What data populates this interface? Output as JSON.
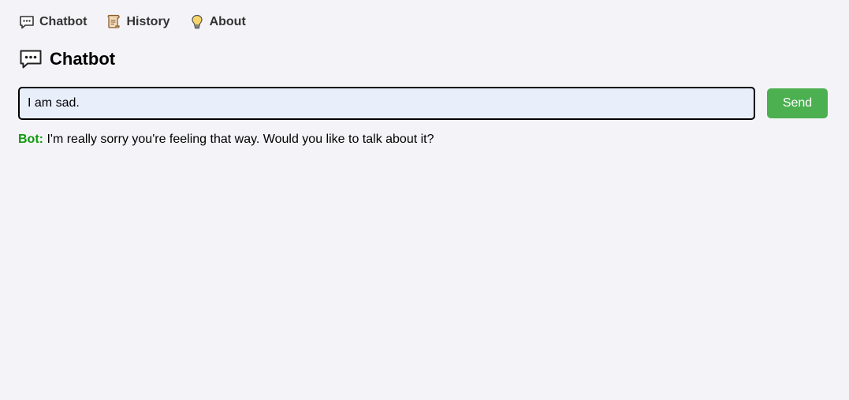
{
  "nav": {
    "items": [
      {
        "label": "Chatbot",
        "icon": "speech-bubble-icon"
      },
      {
        "label": "History",
        "icon": "scroll-icon"
      },
      {
        "label": "About",
        "icon": "lightbulb-icon"
      }
    ]
  },
  "page": {
    "title": "Chatbot",
    "title_icon": "speech-bubble-icon"
  },
  "chat": {
    "input_value": "I am sad.",
    "send_label": "Send",
    "bot_label": "Bot:",
    "bot_response": "I'm really sorry you're feeling that way. Would you like to talk about it?"
  },
  "colors": {
    "background": "#f4f4f8",
    "input_background": "#e8effb",
    "send_button": "#4caf50",
    "bot_label": "#119a0f"
  }
}
